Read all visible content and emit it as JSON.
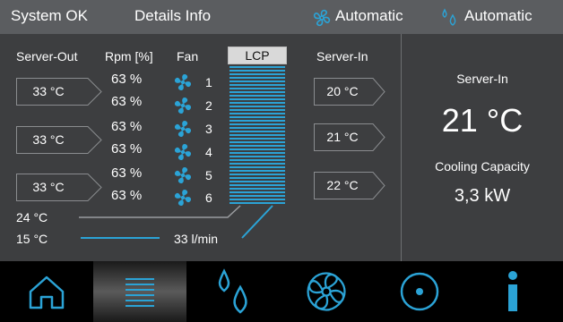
{
  "topbar": {
    "status": "System OK",
    "details": "Details Info",
    "fan_mode": "Automatic",
    "water_mode": "Automatic"
  },
  "headers": {
    "server_out": "Server-Out",
    "rpm": "Rpm [%]",
    "fan": "Fan",
    "lcp": "LCP",
    "server_in": "Server-In"
  },
  "server_out": [
    "33 °C",
    "33 °C",
    "33 °C"
  ],
  "server_in_temps": [
    "20 °C",
    "21 °C",
    "22 °C"
  ],
  "fans": [
    {
      "rpm": "63 %",
      "num": "1"
    },
    {
      "rpm": "63 %",
      "num": "2"
    },
    {
      "rpm": "63 %",
      "num": "3"
    },
    {
      "rpm": "63 %",
      "num": "4"
    },
    {
      "rpm": "63 %",
      "num": "5"
    },
    {
      "rpm": "63 %",
      "num": "6"
    }
  ],
  "water": {
    "return_temp": "24 °C",
    "supply_temp": "15 °C",
    "flow": "33 l/min"
  },
  "summary": {
    "server_in_label": "Server-In",
    "server_in_value": "21 °C",
    "cooling_label": "Cooling  Capacity",
    "cooling_value": "3,3 kW"
  },
  "nav": {
    "items": [
      "home-icon",
      "menu-icon",
      "water-icon",
      "fan-icon",
      "circle-icon",
      "info-icon"
    ],
    "active_index": 1
  },
  "colors": {
    "accent": "#2ba3d6",
    "panel": "#3d3e40",
    "topbar": "#5b5d60"
  }
}
